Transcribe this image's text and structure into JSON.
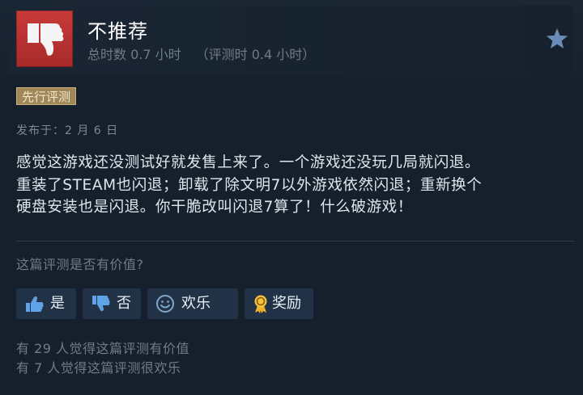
{
  "header": {
    "verdict": "不推荐",
    "playtime_total": "总时数 0.7 小时",
    "playtime_at_review": "（评测时 0.4 小时）",
    "verdict_color": "#c93a3a"
  },
  "badge": {
    "label": "先行评测"
  },
  "review": {
    "date": "发布于：2 月 6 日",
    "lines": [
      "感觉这游戏还没测试好就发售上来了。一个游戏还没玩几局就闪退。",
      "重装了STEAM也闪退；卸载了除文明7以外游戏依然闪退；重新换个",
      "硬盘安装也是闪退。你干脆改叫闪退7算了！什么破游戏！"
    ]
  },
  "feedback": {
    "question": "这篇评测是否有价值?",
    "yes_label": "是",
    "no_label": "否",
    "funny_label": "欢乐",
    "award_label": "奖励"
  },
  "stats": {
    "helpful": "有 29 人觉得这篇评测有价值",
    "funny": "有 7 人觉得这篇评测很欢乐"
  },
  "icons": {
    "verdict": "thumbs-down-icon",
    "favorite": "star-icon",
    "yes": "thumbs-up-icon",
    "no": "thumbs-down-icon",
    "funny": "smiley-icon",
    "award": "award-ribbon-icon"
  }
}
